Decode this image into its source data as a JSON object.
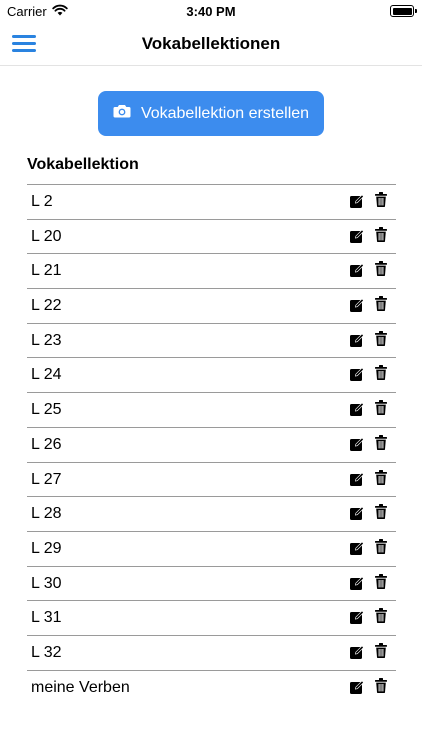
{
  "status_bar": {
    "carrier": "Carrier",
    "time": "3:40 PM"
  },
  "nav": {
    "title": "Vokabellektionen",
    "menu_icon": "hamburger-menu-icon"
  },
  "create_button": {
    "label": "Vokabellektion erstellen",
    "icon": "camera-icon"
  },
  "list": {
    "header": "Vokabellektion",
    "items": [
      {
        "label": "L 2"
      },
      {
        "label": "L 20"
      },
      {
        "label": "L 21"
      },
      {
        "label": "L 22"
      },
      {
        "label": "L 23"
      },
      {
        "label": "L 24"
      },
      {
        "label": "L 25"
      },
      {
        "label": "L 26"
      },
      {
        "label": "L 27"
      },
      {
        "label": "L 28"
      },
      {
        "label": "L 29"
      },
      {
        "label": "L 30"
      },
      {
        "label": "L 31"
      },
      {
        "label": "L 32"
      },
      {
        "label": "meine Verben"
      }
    ]
  },
  "colors": {
    "accent": "#3c8cee",
    "menu": "#2a83e0",
    "divider": "#9a9a9a"
  }
}
